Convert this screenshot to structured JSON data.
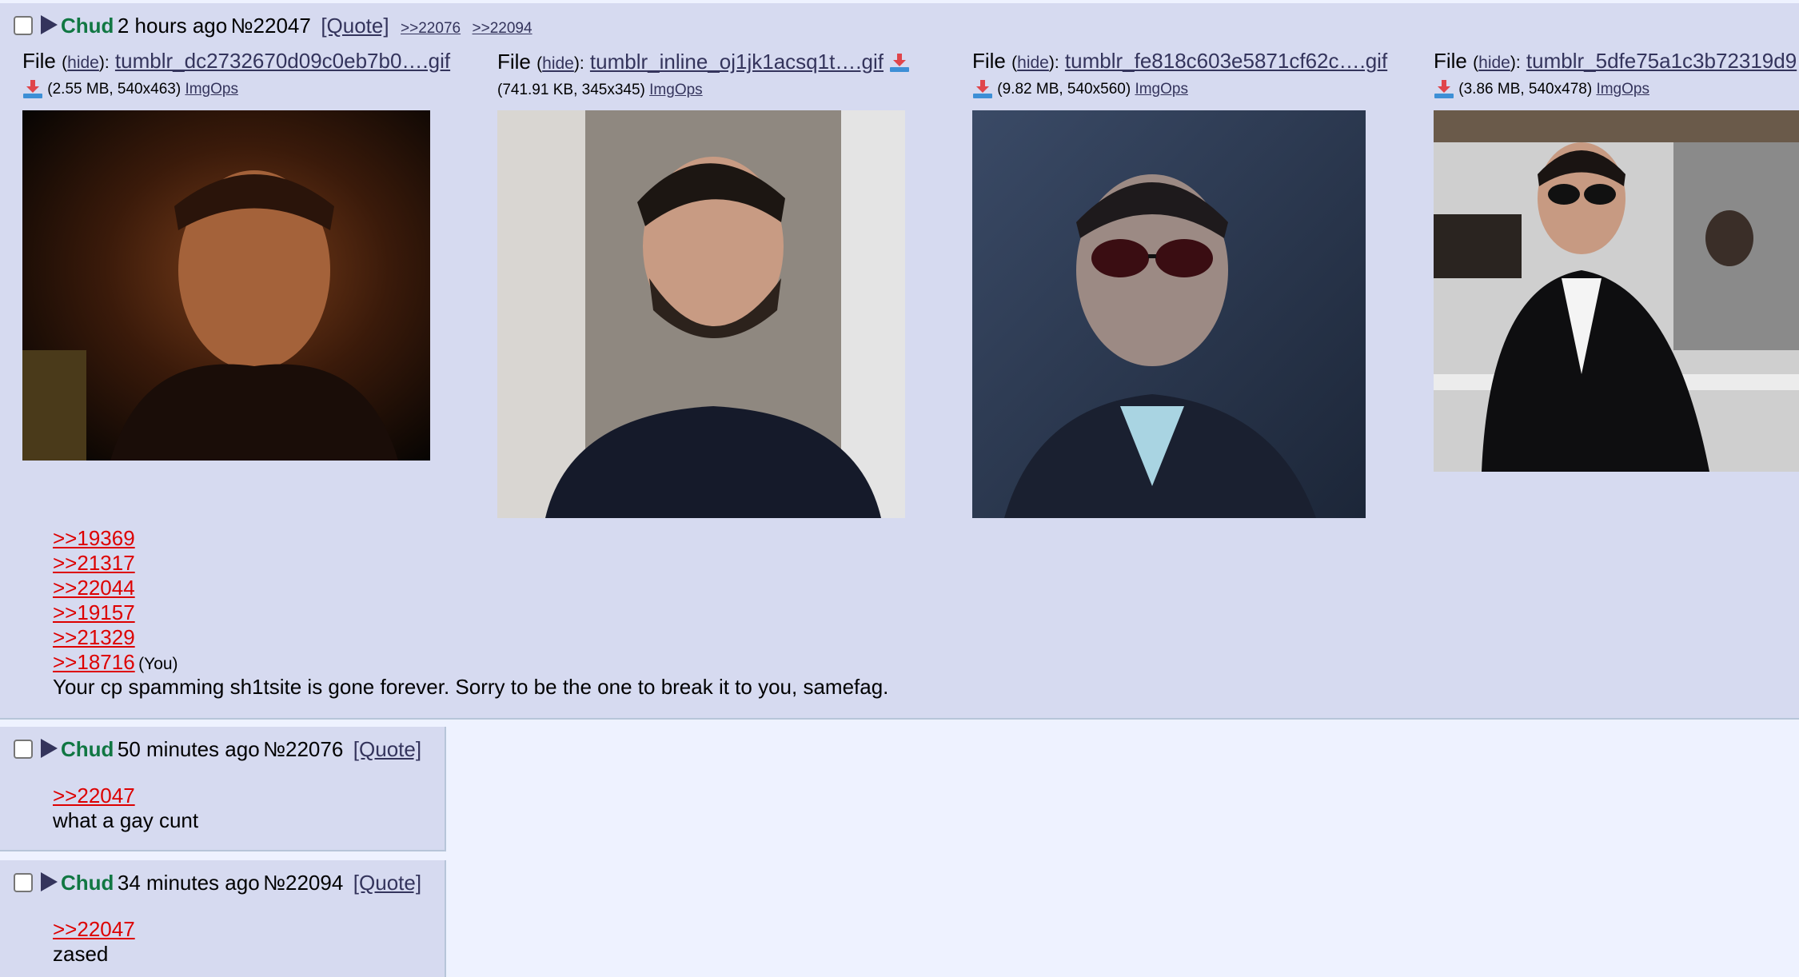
{
  "op": {
    "name": "Chud",
    "time": "2 hours ago",
    "number": "№22047",
    "quote_label": "[Quote]",
    "backlinks": [
      ">>22076",
      ">>22094"
    ],
    "files": [
      {
        "label": "File",
        "hide": "hide",
        "name": "tumblr_dc2732670d09c0eb7b0….gif",
        "size": "(2.55 MB, 540x463)",
        "imgops": "ImgOps"
      },
      {
        "label": "File",
        "hide": "hide",
        "name": "tumblr_inline_oj1jk1acsq1t….gif",
        "size": "(741.91 KB, 345x345)",
        "imgops": "ImgOps"
      },
      {
        "label": "File",
        "hide": "hide",
        "name": "tumblr_fe818c603e5871cf62c….gif",
        "size": "(9.82 MB, 540x560)",
        "imgops": "ImgOps"
      },
      {
        "label": "File",
        "hide": "hide",
        "name": "tumblr_5dfe75a1c3b72319d9",
        "size": "(3.86 MB, 540x478)",
        "imgops": "ImgOps"
      }
    ],
    "reply_links": [
      ">>19369",
      ">>21317",
      ">>22044",
      ">>19157",
      ">>21329",
      ">>18716"
    ],
    "you_label": "(You)",
    "message": "Your cp spamming sh1tsite is gone forever. Sorry to be the one to break it to you, samefag."
  },
  "replies": [
    {
      "name": "Chud",
      "time": "50 minutes ago",
      "number": "№22076",
      "quote_label": "[Quote]",
      "link": ">>22047",
      "message": "what a gay cunt"
    },
    {
      "name": "Chud",
      "time": "34 minutes ago",
      "number": "№22094",
      "quote_label": "[Quote]",
      "link": ">>22047",
      "message": "zased"
    }
  ],
  "colors": {
    "page_bg": "#eef2ff",
    "post_bg": "#d6daf0",
    "name": "#117743",
    "link": "#34345c",
    "reply_link": "#dd0000"
  },
  "icons": {
    "download": "download-icon",
    "expand": "triangle-icon"
  }
}
